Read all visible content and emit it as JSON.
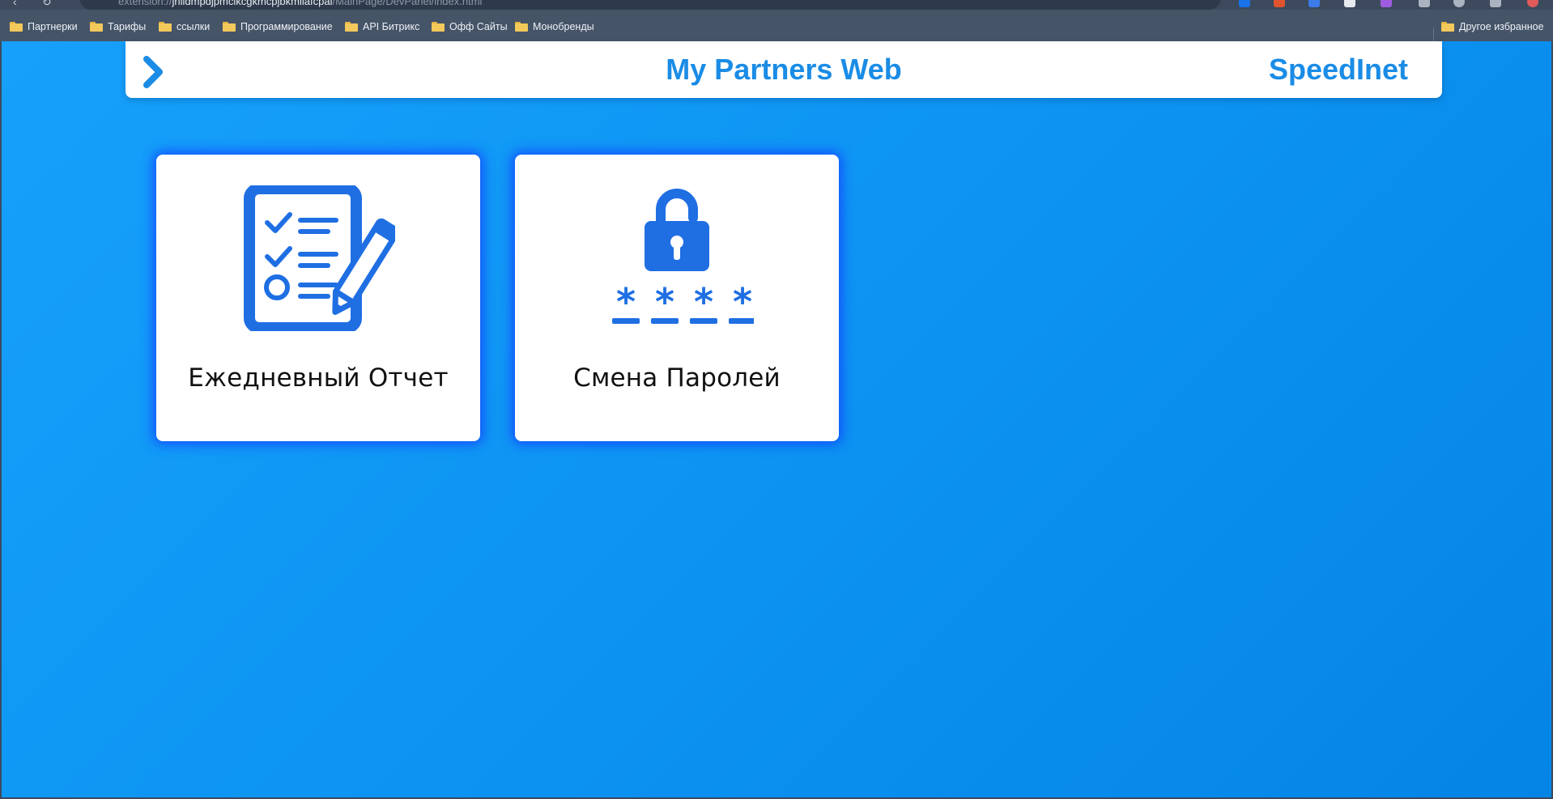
{
  "browser": {
    "address": {
      "prefix": "extension://",
      "host": "jnlldmpdjpmclkcgkmcpjbkmllafcpal",
      "path": "/MainPage/DevPanel/index.html"
    },
    "bookmarks": [
      {
        "label": "Партнерки",
        "icon": "folder-icon"
      },
      {
        "label": "Тарифы",
        "icon": "folder-icon"
      },
      {
        "label": "ссылки",
        "icon": "folder-icon"
      },
      {
        "label": "Программирование",
        "icon": "folder-icon"
      },
      {
        "label": "API Битрикс",
        "icon": "folder-icon"
      },
      {
        "label": "Офф Сайты",
        "icon": "folder-icon"
      },
      {
        "label": "Монобренды",
        "icon": "folder-icon"
      }
    ],
    "other_bookmarks": "Другое избранное"
  },
  "header": {
    "title": "My Partners Web",
    "brand": "SpeedInet",
    "menu_icon": "chevron-right-icon"
  },
  "cards": [
    {
      "label": "Ежедневный Отчет",
      "icon": "checklist-pencil-icon"
    },
    {
      "label": "Смена Паролей",
      "icon": "padlock-password-icon"
    }
  ],
  "colors": {
    "accent": "#1a8ce6",
    "icon_blue": "#1f6fe3",
    "background_start": "#16a0fb",
    "background_end": "#0485e6",
    "card_glow": "#143cff"
  }
}
